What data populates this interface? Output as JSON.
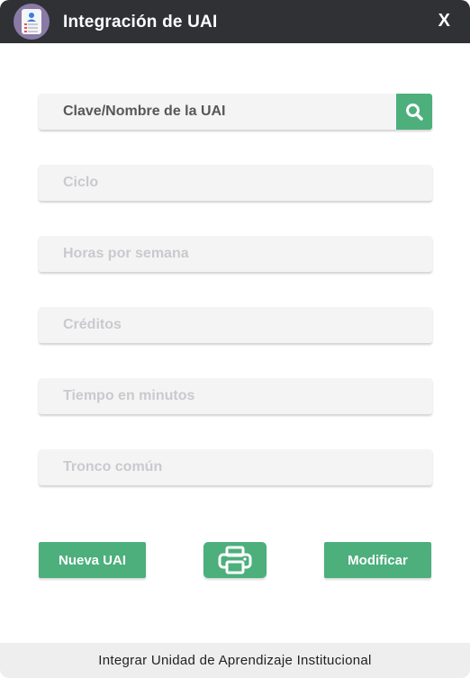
{
  "window": {
    "title": "Integración de UAI",
    "close_label": "X",
    "app_icon": "contact-card-icon"
  },
  "form": {
    "search_placeholder": "Clave/Nombre de la UAI",
    "search_icon": "search-icon",
    "ciclo_placeholder": "Ciclo",
    "horas_placeholder": "Horas por semana",
    "creditos_placeholder": "Créditos",
    "tiempo_placeholder": "Tiempo en minutos",
    "tronco_placeholder": "Tronco común"
  },
  "actions": {
    "nueva_label": "Nueva UAI",
    "print_icon": "printer-icon",
    "modificar_label": "Modificar"
  },
  "footer": {
    "text": "Integrar Unidad de Aprendizaje Institucional"
  },
  "colors": {
    "titlebar": "#2f3135",
    "accent": "#4caf7c",
    "field_bg": "#f4f4f5",
    "footer_bg": "#eeeeef"
  }
}
